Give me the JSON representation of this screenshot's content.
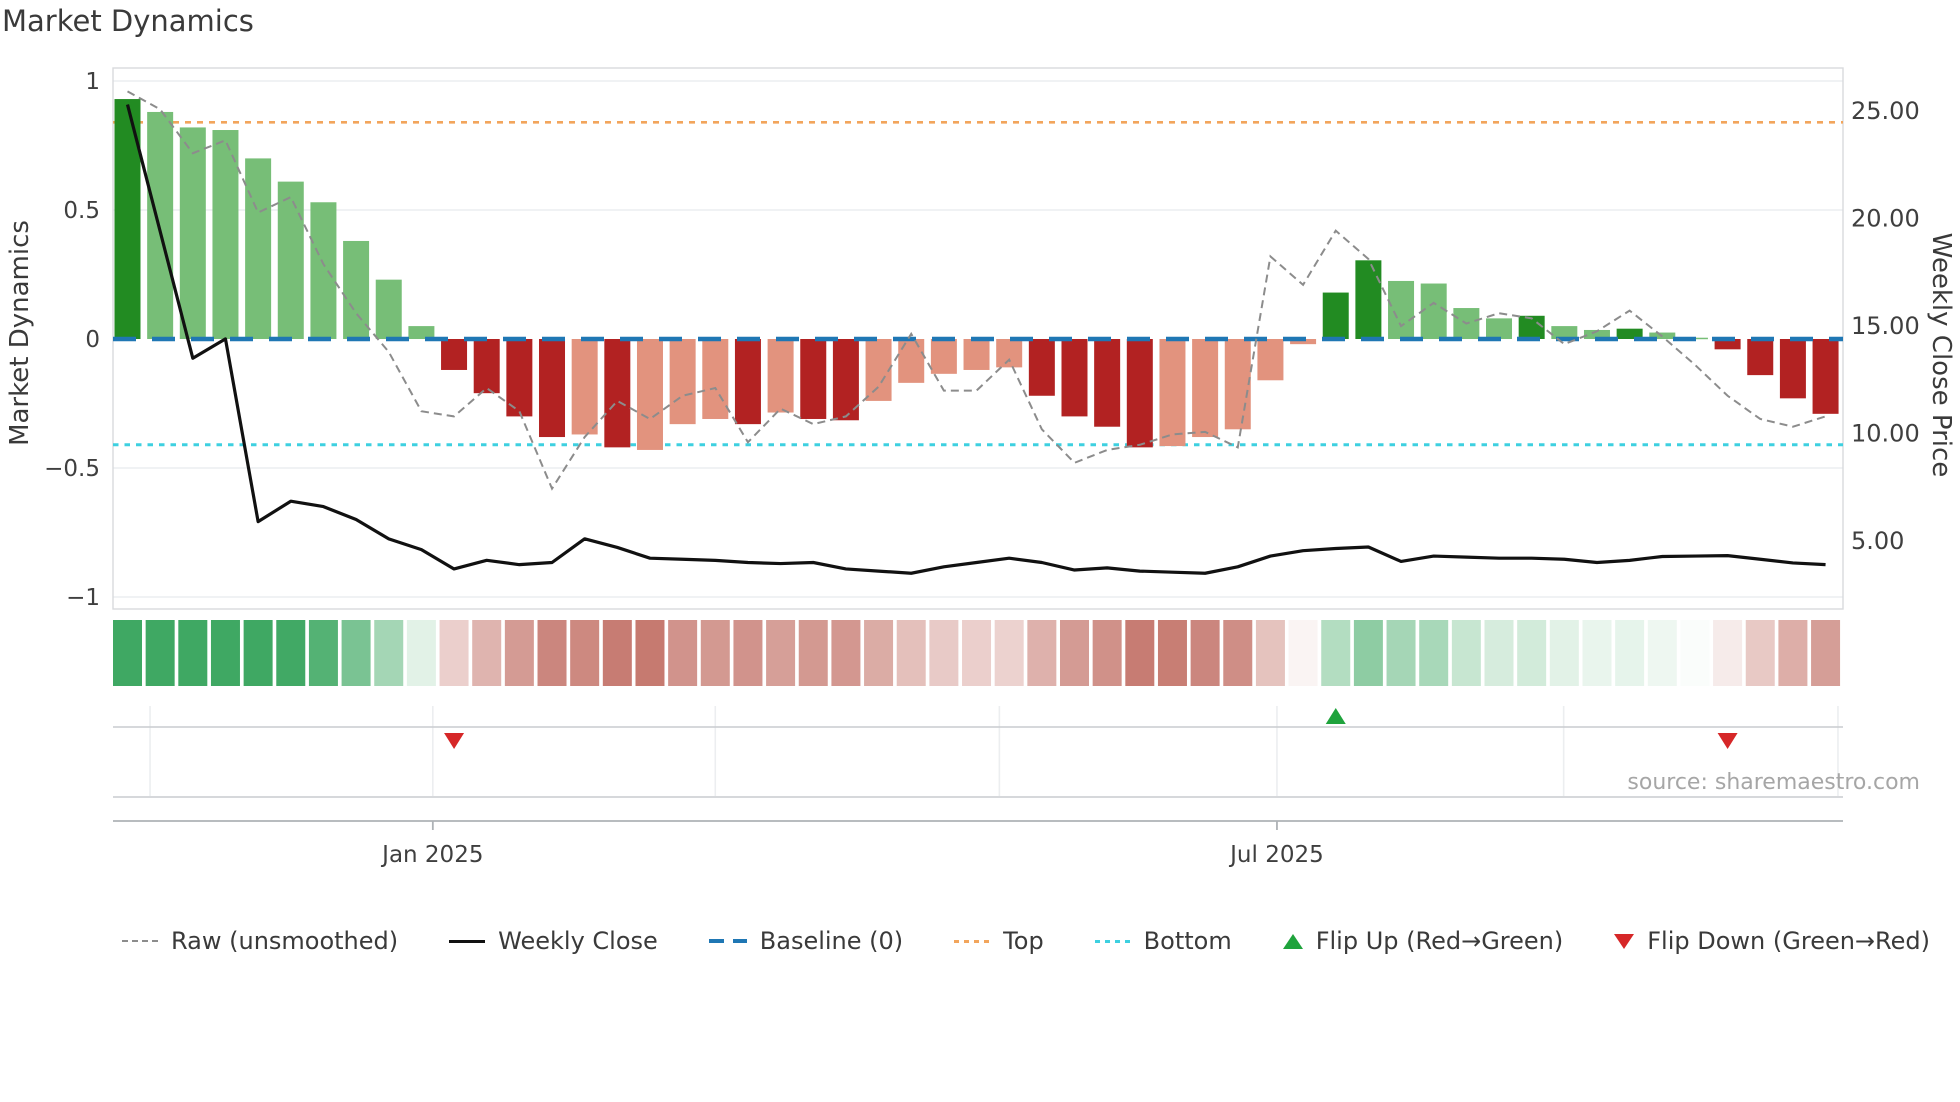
{
  "title": "Market Dynamics",
  "source_note": "source: sharemaestro.com",
  "left_axis": {
    "title": "Market Dynamics",
    "tick_labels": [
      "1",
      "0.5",
      "0",
      "−0.5",
      "−1"
    ],
    "tick_values": [
      1,
      0.5,
      0,
      -0.5,
      -1
    ],
    "range": [
      -1.05,
      1.05
    ]
  },
  "right_axis": {
    "title": "Weekly Close Price",
    "tick_labels": [
      "25.00",
      "20.00",
      "15.00",
      "10.00",
      "5.00"
    ],
    "tick_values": [
      25,
      20,
      15,
      10,
      5
    ]
  },
  "x_axis": {
    "tick_labels": [
      "Jan 2025",
      "Jul 2025"
    ],
    "tick_week_positions": [
      10.35,
      36.2
    ],
    "month_gridline_week_positions": [
      1.69,
      10.35,
      19.0,
      27.7,
      36.2,
      44.98,
      53.38
    ]
  },
  "legend": {
    "items": [
      {
        "label": "Raw (unsmoothed)"
      },
      {
        "label": "Weekly Close"
      },
      {
        "label": "Baseline (0)"
      },
      {
        "label": "Top"
      },
      {
        "label": "Bottom"
      },
      {
        "label": "Flip Up (Red→Green)"
      },
      {
        "label": "Flip Down (Green→Red)"
      }
    ]
  },
  "colors": {
    "bar_green_dark": "#228B22",
    "bar_green_light": "#77BE77",
    "bar_red_dark": "#B22222",
    "bar_red_light": "#E2937E",
    "top_line": "#F2A55C",
    "bottom_line": "#3ED0E0",
    "baseline": "#1F77B4",
    "weekly_close": "#111111",
    "raw_line": "#8C8C8C",
    "flip_up": "#1FA33C",
    "flip_down": "#D62728",
    "heat_green_base": "#3FA863",
    "heat_pink_base": "#C4756B",
    "grid": "#ECEEF0",
    "spine": "#D8DADD",
    "mini_line": "#C9CCCF",
    "axis_line": "#AEB2B6",
    "tick_text": "#3F3F3F"
  },
  "chart_data": {
    "type": "combo",
    "weeks": 53,
    "series": [
      {
        "name": "Market Dynamics (smoothed oscillator bars)",
        "type": "bar",
        "axis": "left",
        "values": [
          0.93,
          0.88,
          0.82,
          0.81,
          0.7,
          0.61,
          0.53,
          0.38,
          0.23,
          0.05,
          -0.12,
          -0.21,
          -0.3,
          -0.38,
          -0.37,
          -0.42,
          -0.43,
          -0.33,
          -0.31,
          -0.33,
          -0.285,
          -0.31,
          -0.315,
          -0.24,
          -0.17,
          -0.135,
          -0.12,
          -0.11,
          -0.22,
          -0.3,
          -0.34,
          -0.42,
          -0.415,
          -0.38,
          -0.35,
          -0.16,
          -0.02,
          0.18,
          0.305,
          0.225,
          0.215,
          0.12,
          0.08,
          0.09,
          0.05,
          0.035,
          0.04,
          0.025,
          0.005,
          -0.04,
          -0.14,
          -0.23,
          -0.29
        ],
        "tones": [
          "dark",
          "light",
          "light",
          "light",
          "light",
          "light",
          "light",
          "light",
          "light",
          "light",
          "dark",
          "dark",
          "dark",
          "dark",
          "light",
          "dark",
          "light",
          "light",
          "light",
          "dark",
          "light",
          "dark",
          "dark",
          "light",
          "light",
          "light",
          "light",
          "light",
          "dark",
          "dark",
          "dark",
          "dark",
          "light",
          "light",
          "light",
          "light",
          "light",
          "dark",
          "dark",
          "light",
          "light",
          "light",
          "light",
          "dark",
          "light",
          "light",
          "dark",
          "light",
          "light",
          "dark",
          "dark",
          "dark",
          "dark"
        ]
      },
      {
        "name": "Raw (unsmoothed)",
        "type": "line",
        "style": "dashed",
        "axis": "left",
        "values": [
          0.96,
          0.89,
          0.72,
          0.77,
          0.49,
          0.55,
          0.29,
          0.1,
          -0.05,
          -0.28,
          -0.3,
          -0.19,
          -0.28,
          -0.58,
          -0.38,
          -0.24,
          -0.31,
          -0.22,
          -0.19,
          -0.4,
          -0.27,
          -0.33,
          -0.3,
          -0.185,
          0.02,
          -0.2,
          -0.2,
          -0.08,
          -0.35,
          -0.48,
          -0.43,
          -0.41,
          -0.37,
          -0.36,
          -0.42,
          0.32,
          0.21,
          0.42,
          0.31,
          0.05,
          0.14,
          0.06,
          0.1,
          0.08,
          -0.02,
          0.03,
          0.11,
          0.01,
          -0.1,
          -0.22,
          -0.31,
          -0.34,
          -0.3
        ]
      },
      {
        "name": "Weekly Close",
        "type": "line",
        "style": "solid",
        "axis": "right",
        "values": [
          25.3,
          19.4,
          13.5,
          14.4,
          5.9,
          6.85,
          6.6,
          6.0,
          5.1,
          4.6,
          3.7,
          4.1,
          3.9,
          4.0,
          5.1,
          4.7,
          4.2,
          4.15,
          4.1,
          4.0,
          3.95,
          4.0,
          3.7,
          3.6,
          3.5,
          3.8,
          4.0,
          4.2,
          4.0,
          3.65,
          3.75,
          3.6,
          3.55,
          3.5,
          3.8,
          4.3,
          4.55,
          4.65,
          4.72,
          4.05,
          4.3,
          4.25,
          4.2,
          4.2,
          4.15,
          4.0,
          4.1,
          4.28,
          4.3,
          4.32,
          4.15,
          3.98,
          3.9
        ]
      }
    ],
    "reference_lines": {
      "baseline": 0,
      "top": 0.84,
      "bottom": -0.41
    },
    "flip_markers": [
      {
        "week": 11,
        "direction": "down"
      },
      {
        "week": 38,
        "direction": "up"
      },
      {
        "week": 50,
        "direction": "down"
      }
    ],
    "heatmap": {
      "note": "strip of 53 cells shaded by bar value: green for positive, pink for negative"
    },
    "legend_position": "bottom",
    "grid": "horizontal-faint"
  }
}
